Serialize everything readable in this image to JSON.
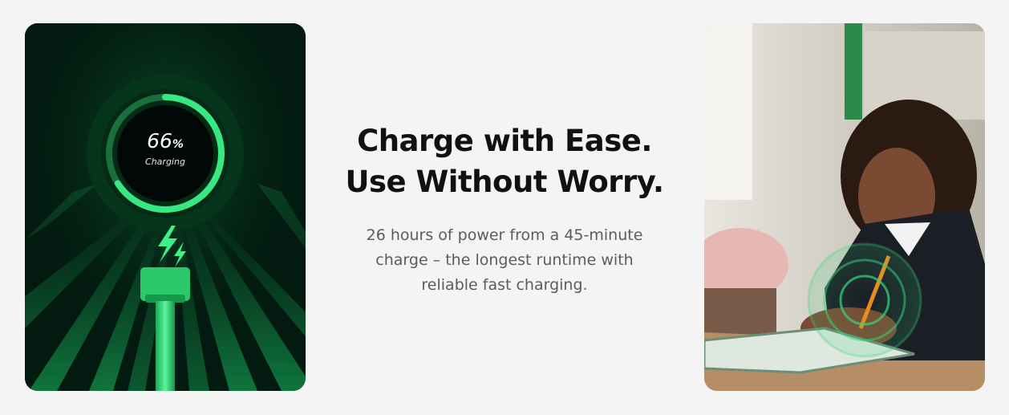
{
  "battery": {
    "percent_value": "66",
    "percent_unit": "%",
    "status": "Charging",
    "level": 0.66
  },
  "hero": {
    "headline_line1": "Charge with Ease.",
    "headline_line2": "Use Without Worry.",
    "body_line1": "26 hours of power from a 45-minute",
    "body_line2": "charge – the longest runtime with",
    "body_line3": "reliable fast charging."
  },
  "colors": {
    "accent_green": "#2be07a",
    "dark_bg": "#031a10",
    "page_bg": "#f4f4f4"
  },
  "icons": [
    "lightning-bolt-icon"
  ],
  "images": [
    "charging-illustration",
    "student-using-tablet-photo"
  ]
}
